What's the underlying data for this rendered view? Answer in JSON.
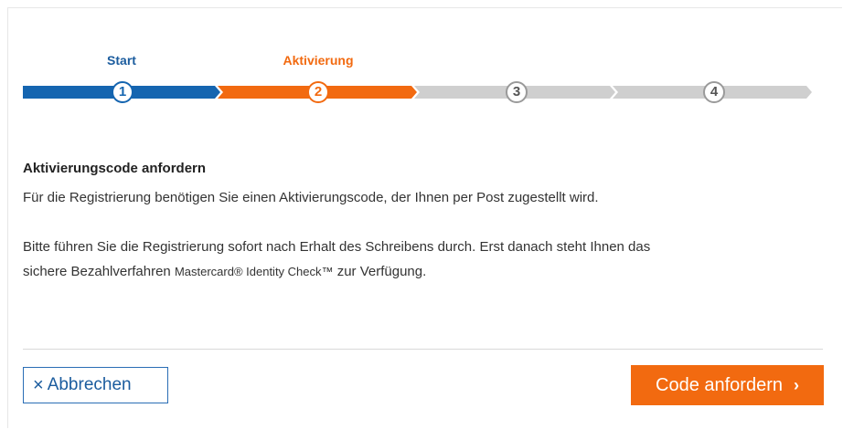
{
  "stepper": {
    "steps": [
      {
        "number": "1",
        "label": "Start",
        "state": "done"
      },
      {
        "number": "2",
        "label": "Aktivierung",
        "state": "active"
      },
      {
        "number": "3",
        "label": "",
        "state": "pending"
      },
      {
        "number": "4",
        "label": "",
        "state": "pending"
      }
    ]
  },
  "content": {
    "title": "Aktivierungscode anfordern",
    "paragraph1": "Für die Registrierung benötigen Sie einen Aktivierungscode, der Ihnen per Post zugestellt wird.",
    "paragraph2_line1": "Bitte führen Sie die Registrierung sofort nach Erhalt des Schreibens durch. Erst danach steht Ihnen das",
    "paragraph2_line2_prefix": "sichere Bezahlverfahren ",
    "paragraph2_brand": "Mastercard® Identity Check™",
    "paragraph2_line2_suffix": " zur Verfügung."
  },
  "actions": {
    "cancel_icon": "×",
    "cancel_label": "Abbrechen",
    "submit_label": "Code anfordern",
    "submit_icon": "›"
  },
  "colors": {
    "primary_blue": "#1565b0",
    "accent_orange": "#f26a10",
    "inactive_gray": "#cfcfcf"
  }
}
